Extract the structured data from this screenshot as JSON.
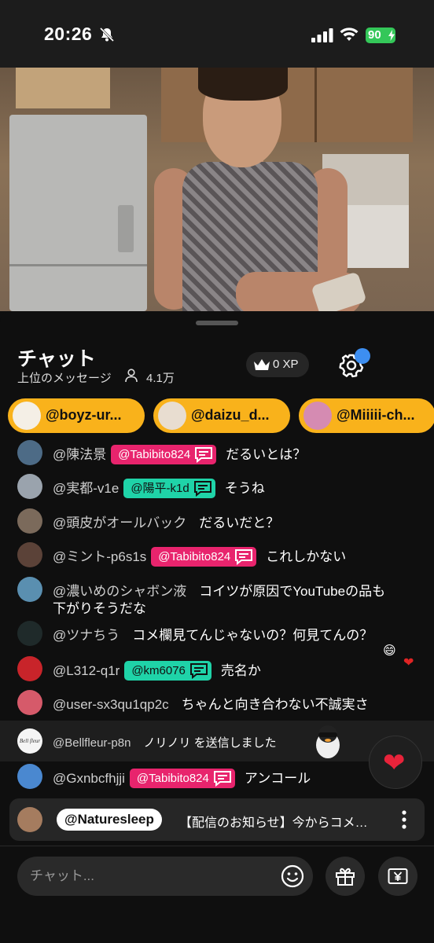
{
  "status_bar": {
    "time": "20:26",
    "battery": "90"
  },
  "chat_header": {
    "title": "チャット",
    "subtitle": "上位のメッセージ",
    "viewer_count": "4.1万",
    "xp": "0 XP"
  },
  "gift_pills": [
    {
      "name": "@boyz-ur..."
    },
    {
      "name": "@daizu_d..."
    },
    {
      "name": "@Miiiii-ch..."
    }
  ],
  "messages": [
    {
      "user": "@陳法景",
      "tag": "@Tabibito824",
      "text": "だるいとは？"
    },
    {
      "user": "@実都-v1e",
      "tag": "@陽平-k1d",
      "text": "そうね"
    },
    {
      "user": "@頭皮がオールバック",
      "text": "だるいだと？"
    },
    {
      "user": "@ミント-p6s1s",
      "tag": "@Tabibito824",
      "text": "これしかない"
    },
    {
      "user": "@濃いめのシャボン液",
      "text": "コイツが原因でYouTubeの品も",
      "text2": "下がりそうだな"
    },
    {
      "user": "@ツナちう",
      "text": "コメ欄見てんじゃないの？何見てんの？"
    },
    {
      "user": "@L312-q1r",
      "tag": "@km6076",
      "text": "売名か"
    },
    {
      "user": "@user-sx3qu1qp2c",
      "text": "ちゃんと向き合わない不誠実さ"
    },
    {
      "user": "@Bellfleur-p8n",
      "text": "ノリノリ を送信しました",
      "avatar_logo": "Bell fleur"
    },
    {
      "user": "@Gxnbcfhjji",
      "tag": "@Tabibito824",
      "text": "アンコール"
    }
  ],
  "floating_emojis": [
    "😄",
    "❤"
  ],
  "heart_button": "❤",
  "pinned": {
    "user": "@Naturesleep",
    "text": "【配信のお知らせ】今からコメ…"
  },
  "input": {
    "placeholder": "チャット..."
  },
  "icons": [
    "bell-slash-icon",
    "signal-icon",
    "wifi-icon",
    "battery-icon",
    "person-icon",
    "crown-icon",
    "gear-icon",
    "reply-icon",
    "more-vertical-icon",
    "smile-icon",
    "gift-icon",
    "yen-icon"
  ],
  "colors": {
    "accent_yellow": "#f9b21b",
    "tag_pink": "#e8246d",
    "tag_teal": "#1fd3a8",
    "badge_blue": "#3d8ef0",
    "battery_green": "#34c759"
  }
}
